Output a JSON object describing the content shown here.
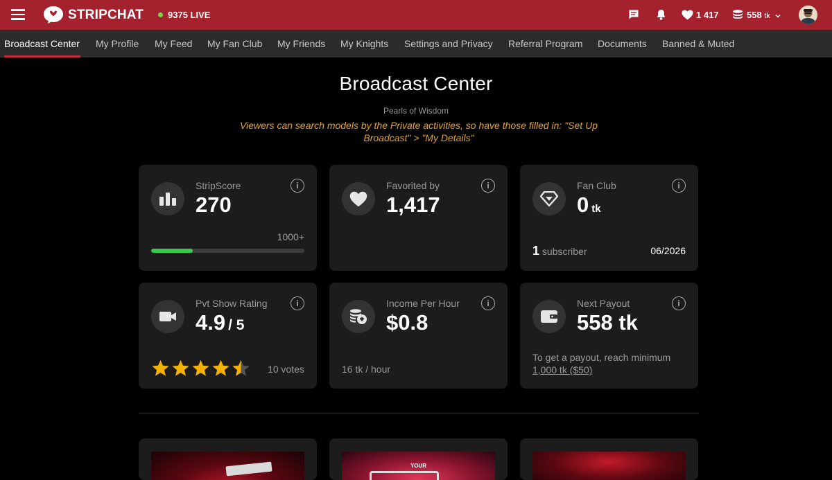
{
  "header": {
    "brand": "STRIPCHAT",
    "live_count": "9375 LIVE",
    "favorites_count": "1 417",
    "tokens_value": "558",
    "tokens_unit": "tk",
    "colors": {
      "brand": "#a3222e",
      "live_dot": "#7ed14c"
    }
  },
  "nav": {
    "items": [
      {
        "label": "Broadcast Center",
        "active": true
      },
      {
        "label": "My Profile"
      },
      {
        "label": "My Feed"
      },
      {
        "label": "My Fan Club"
      },
      {
        "label": "My Friends"
      },
      {
        "label": "My Knights"
      },
      {
        "label": "Settings and Privacy"
      },
      {
        "label": "Referral Program"
      },
      {
        "label": "Documents"
      },
      {
        "label": "Banned & Muted"
      }
    ]
  },
  "page": {
    "title": "Broadcast Center",
    "pearls": "Pearls of Wisdom",
    "tip": "Viewers can search models by the Private activities, so have those filled in: \"Set Up Broadcast\" > \"My Details\""
  },
  "cards": {
    "stripscore": {
      "label": "StripScore",
      "value": "270",
      "next_level": "1000+",
      "progress": 0.27,
      "icon": "bar-chart-icon"
    },
    "favorited": {
      "label": "Favorited by",
      "value": "1,417",
      "icon": "heart-icon"
    },
    "fanclub": {
      "label": "Fan Club",
      "value": "0",
      "unit": "tk",
      "subscriber_count": "1",
      "subscriber_label": "subscriber",
      "date": "06/2026",
      "icon": "diamond-icon"
    },
    "rating": {
      "label": "Pvt Show Rating",
      "value": "4.9",
      "max": "/ 5",
      "votes": "10 votes",
      "stars": 4.5,
      "icon": "video-camera-icon"
    },
    "income": {
      "label": "Income Per Hour",
      "value": "$0.8",
      "sub": "16 tk / hour",
      "icon": "coins-icon"
    },
    "payout": {
      "label": "Next Payout",
      "value": "558 tk",
      "hint": "To get a payout, reach minimum",
      "minimum": "1,000 tk ($50)",
      "icon": "wallet-icon"
    }
  },
  "promo": {
    "banner_text": "YOUR"
  }
}
